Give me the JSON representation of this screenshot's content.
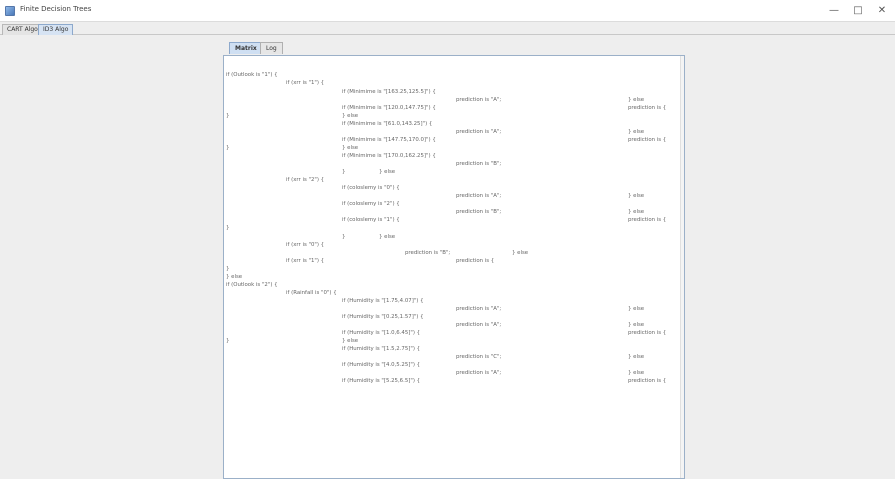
{
  "window": {
    "title": "Finite Decision Trees",
    "minimize": "—",
    "maximize": "□",
    "close": "✕"
  },
  "top_tabs": [
    {
      "label": "CART Algo"
    },
    {
      "label": "ID3 Algo"
    }
  ],
  "inner_tabs": [
    {
      "label": "Matrix"
    },
    {
      "label": "Log"
    }
  ],
  "tree_lines": [
    "if (Outlook is \"1\") {",
    "if (xrr is \"1\") {",
    "if (Minimime is \"[163.25,125.5]\") {",
    "prediction is \"A\";",
    "} else",
    "if (Minimime is \"[120.0,147.75]\") {",
    "prediction is {",
    "}",
    "} else",
    "if (Minimime is \"[61.0,143.25]\") {",
    "prediction is \"A\";",
    "} else",
    "if (Minimime is \"[147.75,170.0]\") {",
    "prediction is {",
    "}",
    "} else",
    "if (Minimime is \"[170.0,162.25]\") {",
    "prediction is \"B\";",
    "}",
    "} else",
    "if (xrr is \"2\") {",
    "if (coloslemy is \"0\") {",
    "prediction is \"A\";",
    "} else",
    "if (coloslemy is \"2\") {",
    "prediction is \"B\";",
    "} else",
    "if (coloslemy is \"1\") {",
    "prediction is {",
    "}",
    "}",
    "} else",
    "if (xrr is \"0\") {",
    "prediction is \"B\";",
    "} else",
    "if (xrr is \"1\") {",
    "prediction is {",
    "}",
    "} else",
    "if (Outlook is \"2\") {",
    "if (Rainfall is \"0\") {",
    "if (Humidity is \"[1.75,4.07]\") {",
    "prediction is \"A\";",
    "} else",
    "if (Humidity is \"[0.25,1.57]\") {",
    "prediction is \"A\";",
    "} else",
    "if (Humidity is \"[1.0,6.45]\") {",
    "prediction is {",
    "}",
    "} else",
    "if (Humidity is \"[1.5,2.75]\") {",
    "prediction is \"C\";",
    "} else",
    "if (Humidity is \"[4.0,5.25]\") {",
    "prediction is \"A\";",
    "} else",
    "if (Humidity is \"[5.25,6.5]\") {",
    "prediction is {"
  ]
}
